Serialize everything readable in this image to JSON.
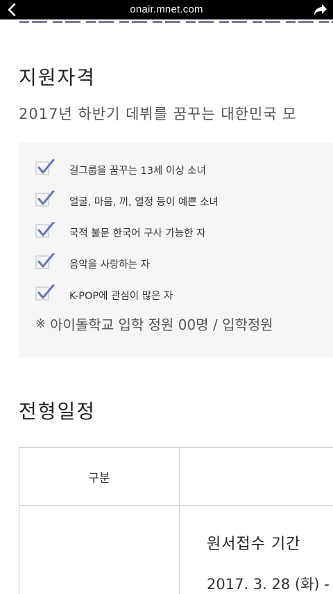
{
  "browser": {
    "url": "onair.mnet.com",
    "back_icon": "chevron-left-icon",
    "share_icon": "share-arrow-icon"
  },
  "qualification": {
    "title": "지원자격",
    "subtitle": "2017년 하반기 데뷔를 꿈꾸는 대한민국 모",
    "items": [
      {
        "label": "걸그룹을 꿈꾸는 13세 이상 소녀"
      },
      {
        "label": "얼굴, 마음, 끼, 열정 등이 예쁜 소녀"
      },
      {
        "label": "국적 불문 한국어 구사 가능한 자"
      },
      {
        "label": "음악을 사랑하는 자"
      },
      {
        "label": "K-POP에 관심이 많은 자"
      }
    ],
    "note_mark": "※",
    "note_text": "아이돌학교 입학 정원 00명 / 입학정원",
    "check_color": "#6b73b8"
  },
  "schedule": {
    "title": "전형일정",
    "table": {
      "header_col1": "구분",
      "row1_title": "원서접수 기간",
      "row1_date": "2017. 3. 28 (화) -"
    }
  }
}
